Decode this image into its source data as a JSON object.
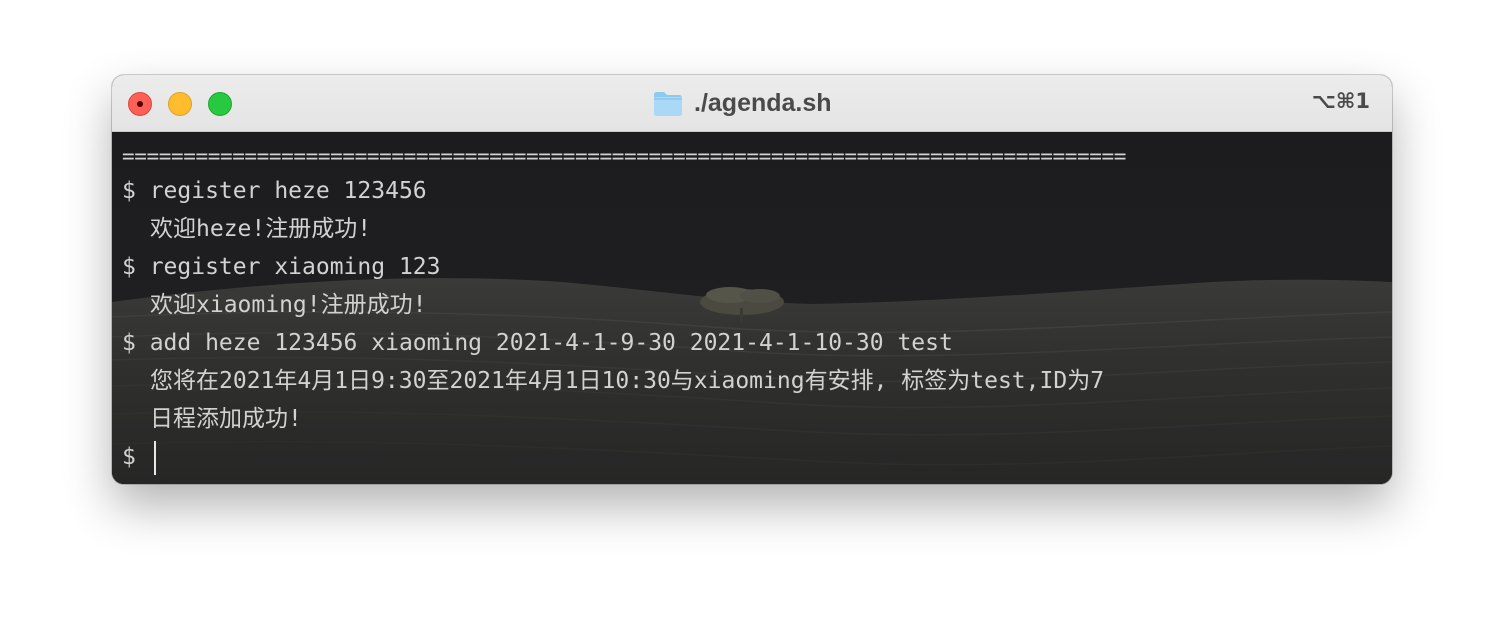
{
  "window": {
    "title": "./agenda.sh",
    "shortcut": "⌥⌘1",
    "icon": "folder-icon"
  },
  "colors": {
    "close": "#fe5f57",
    "minimize": "#febc2e",
    "zoom": "#28c840",
    "terminal_bg": "#202022",
    "text": "#d2d2d2"
  },
  "terminal": {
    "separator": "==================================================================================",
    "lines": [
      {
        "type": "command",
        "text": "$ register heze 123456"
      },
      {
        "type": "output",
        "text": "欢迎heze!注册成功!"
      },
      {
        "type": "command",
        "text": "$ register xiaoming 123"
      },
      {
        "type": "output",
        "text": "欢迎xiaoming!注册成功!"
      },
      {
        "type": "command",
        "text": "$ add heze 123456 xiaoming 2021-4-1-9-30 2021-4-1-10-30 test"
      },
      {
        "type": "output",
        "text": "您将在2021年4月1日9:30至2021年4月1日10:30与xiaoming有安排, 标签为test,ID为7"
      },
      {
        "type": "output",
        "text": "日程添加成功!"
      }
    ],
    "prompt": "$ "
  }
}
